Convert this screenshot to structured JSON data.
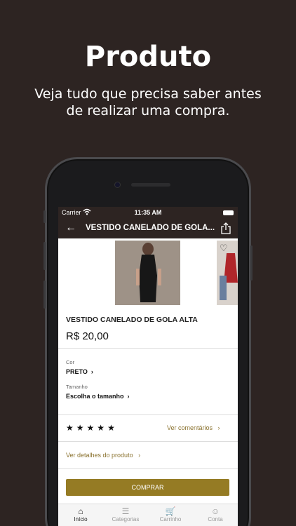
{
  "header": {
    "title": "Produto",
    "subtitle": "Veja tudo que precisa saber antes de realizar uma compra."
  },
  "status": {
    "carrier": "Carrier",
    "time": "11:35 AM"
  },
  "nav": {
    "title": "VESTIDO CANELADO DE GOLA..."
  },
  "product": {
    "name": "VESTIDO CANELADO DE GOLA ALTA",
    "price": "R$ 20,00",
    "color_label": "Cor",
    "color_value": "PRETO",
    "size_label": "Tamanho",
    "size_value": "Escolha o tamanho",
    "rating_stars": 5,
    "comments_link": "Ver comentários",
    "details_link": "Ver detalhes do produto",
    "buy_label": "COMPRAR"
  },
  "tabs": [
    {
      "label": "Início",
      "icon": "home-icon"
    },
    {
      "label": "Categorias",
      "icon": "list-icon"
    },
    {
      "label": "Carrinho",
      "icon": "cart-icon"
    },
    {
      "label": "Conta",
      "icon": "user-icon"
    }
  ],
  "colors": {
    "background": "#2d2422",
    "accent": "#957b24"
  }
}
